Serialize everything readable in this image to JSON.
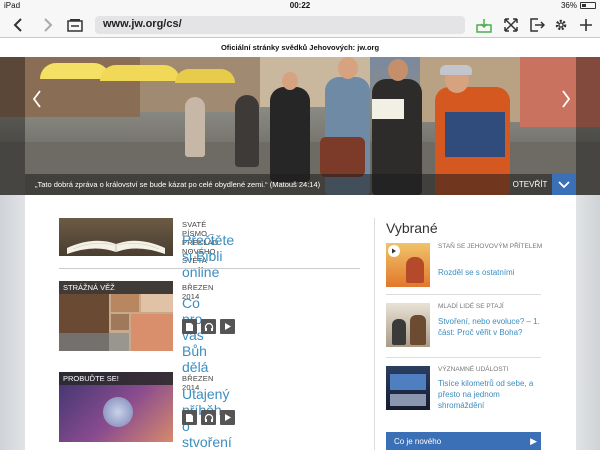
{
  "status_bar": {
    "device": "iPad",
    "time": "00:22",
    "battery": "36%"
  },
  "browser": {
    "url": "www.jw.org/cs/"
  },
  "site_title": "Oficiální stránky svědků Jehovových: jw.org",
  "hero": {
    "caption": "„Tato dobrá zpráva o království se bude kázat po celé obydlené zemi.“ (Matouš 24:14)",
    "open_label": "OTEVŘÍT"
  },
  "articles": [
    {
      "meta": "SVATÉ PÍSMO – PŘEKLAD NOVÉHO SVĚTA",
      "title": "Přečtěte si Bibli online",
      "tag": ""
    },
    {
      "meta": "BŘEZEN 2014",
      "title": "Co pro vás Bůh dělá",
      "tag": "STRÁŽNÁ VĚŽ"
    },
    {
      "meta": "BŘEZEN 2014",
      "title": "Utajený příběh o stvoření",
      "tag": "PROBUĎTE SE!"
    }
  ],
  "featured": {
    "heading": "Vybrané",
    "items": [
      {
        "meta": "STAŇ SE JEHOVOVÝM PŘÍTELEM",
        "title": "Rozděl se s ostatními"
      },
      {
        "meta": "MLADÍ LIDÉ SE PTAJÍ",
        "title": "Stvoření, nebo evoluce? – 1. část: Proč věřit v Boha?"
      },
      {
        "meta": "VÝZNAMNÉ UDÁLOSTI",
        "title": "Tisíce kilometrů od sebe, a přesto na jednom shromáždění"
      }
    ],
    "cta": "Co je nového"
  }
}
